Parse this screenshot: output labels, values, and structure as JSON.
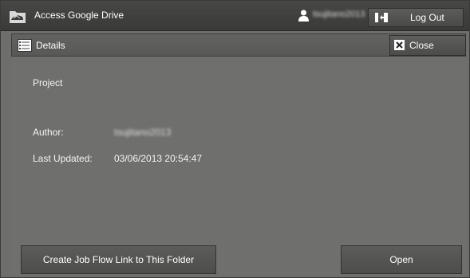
{
  "header": {
    "app_title": "Access Google Drive",
    "user_name": "tsujitano2013",
    "logout_label": "Log Out"
  },
  "details": {
    "title": "Details",
    "close_label": "Close",
    "project_label": "Project",
    "author_label": "Author:",
    "author_value": "tsujitano2013",
    "updated_label": "Last Updated:",
    "updated_value": "03/06/2013 20:54:47"
  },
  "actions": {
    "create_link_label": "Create Job Flow Link to This Folder",
    "open_label": "Open"
  },
  "icons": {
    "app": "folder-cloud-icon",
    "user": "user-icon",
    "logout": "logout-icon",
    "details": "list-details-icon",
    "close": "close-x-icon"
  },
  "colors": {
    "background": "#6e6e6c",
    "header_bg": "#3e3e3c",
    "text": "#ffffff"
  }
}
